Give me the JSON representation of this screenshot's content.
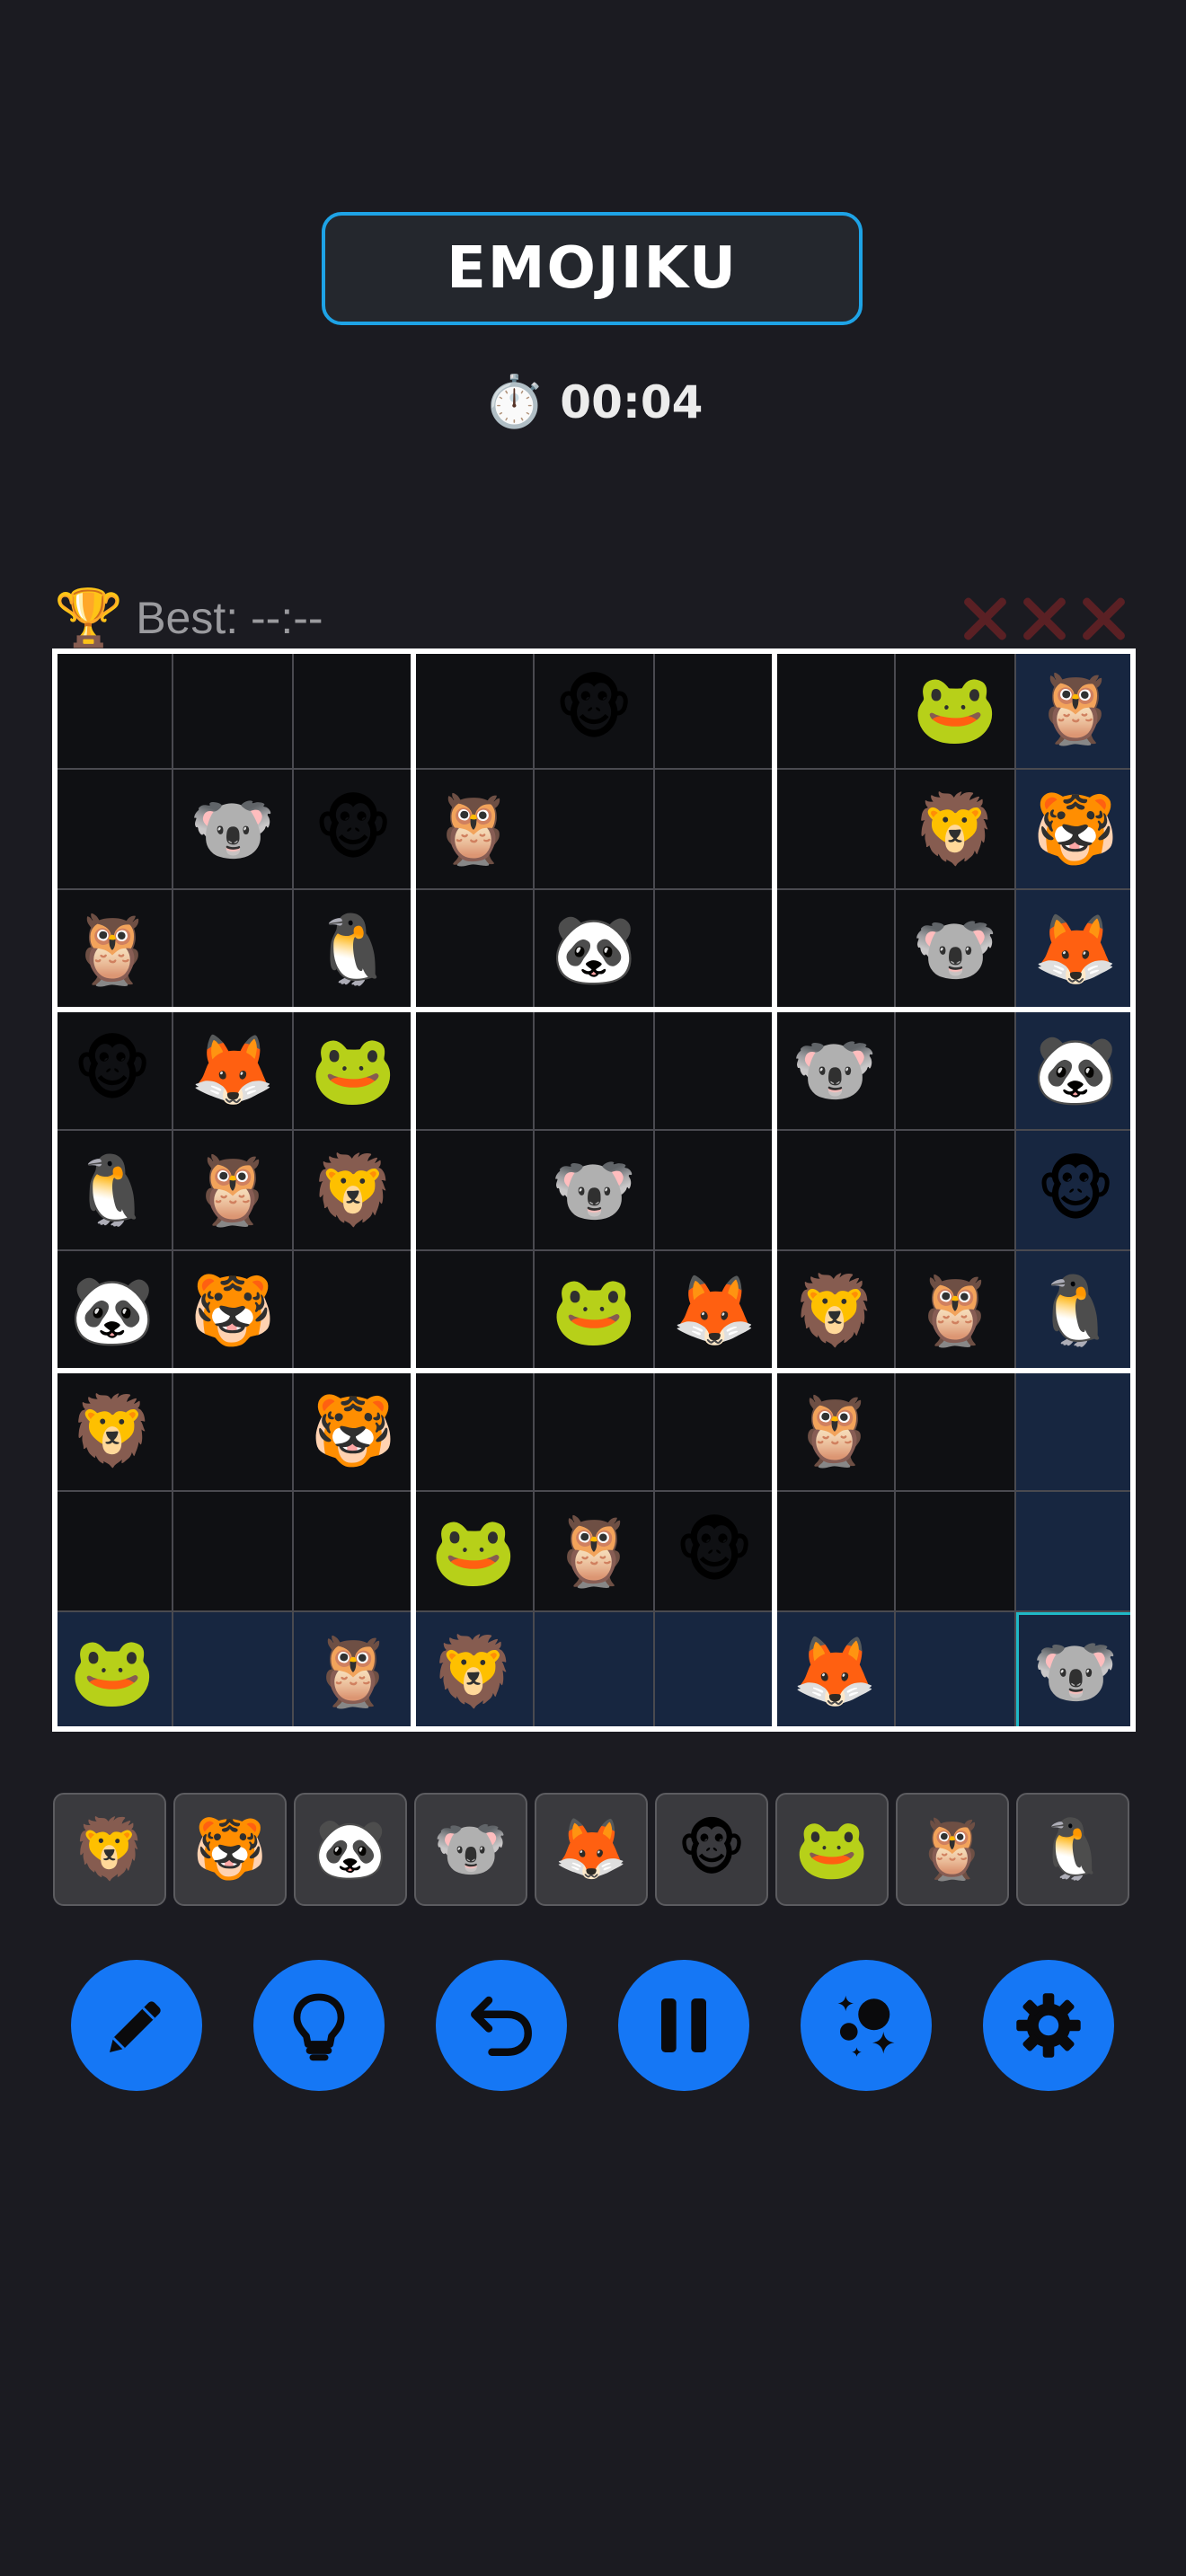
{
  "header": {
    "title": "EMOJIKU",
    "timer_icon": "⏱️",
    "timer": "00:04"
  },
  "stats": {
    "trophy_icon": "🏆",
    "best": "Best: --:--",
    "mistakes": {
      "made": 0,
      "max": 3
    }
  },
  "board": {
    "emoji_legend": {
      "L": "🦁",
      "T": "🐯",
      "P": "🐼",
      "K": "🐨",
      "F": "🦊",
      "M": "🐵",
      "G": "🐸",
      "O": "🦉",
      "U": "🐧"
    },
    "rows": [
      [
        "",
        "",
        "",
        "",
        "🐵",
        "",
        "",
        "🐸",
        "🦉"
      ],
      [
        "",
        "🐨",
        "🐵",
        "🦉",
        "",
        "",
        "",
        "🦁",
        "🐯"
      ],
      [
        "🦉",
        "",
        "🐧",
        "",
        "🐼",
        "",
        "",
        "🐨",
        "🦊"
      ],
      [
        "🐵",
        "🦊",
        "🐸",
        "",
        "",
        "",
        "🐨",
        "",
        "🐼"
      ],
      [
        "🐧",
        "🦉",
        "🦁",
        "",
        "🐨",
        "",
        "",
        "",
        "🐵"
      ],
      [
        "🐼",
        "🐯",
        "",
        "",
        "🐸",
        "🦊",
        "🦁",
        "🦉",
        "🐧"
      ],
      [
        "🦁",
        "",
        "🐯",
        "",
        "",
        "",
        "🦉",
        "",
        ""
      ],
      [
        "",
        "",
        "",
        "🐸",
        "🦉",
        "🐵",
        "",
        "",
        ""
      ],
      [
        "🐸",
        "",
        "🦉",
        "🦁",
        "",
        "",
        "🦊",
        "",
        "🐨"
      ]
    ],
    "selected": {
      "row": 8,
      "col": 8
    }
  },
  "palette": [
    {
      "name": "lion",
      "emoji": "🦁"
    },
    {
      "name": "tiger",
      "emoji": "🐯"
    },
    {
      "name": "panda",
      "emoji": "🐼"
    },
    {
      "name": "koala",
      "emoji": "🐨"
    },
    {
      "name": "fox",
      "emoji": "🦊"
    },
    {
      "name": "monkey",
      "emoji": "🐵"
    },
    {
      "name": "frog",
      "emoji": "🐸"
    },
    {
      "name": "owl",
      "emoji": "🦉"
    },
    {
      "name": "penguin",
      "emoji": "🐧"
    }
  ],
  "toolbar": [
    {
      "name": "pencil-button",
      "icon": "pencil-icon"
    },
    {
      "name": "hint-button",
      "icon": "lightbulb-icon"
    },
    {
      "name": "undo-button",
      "icon": "undo-icon"
    },
    {
      "name": "pause-button",
      "icon": "pause-icon"
    },
    {
      "name": "magic-button",
      "icon": "sparkles-icon"
    },
    {
      "name": "settings-button",
      "icon": "gear-icon"
    }
  ],
  "colors": {
    "background": "#1b1b21",
    "accent": "#1577f5",
    "title_border": "#1ea3e6",
    "highlight": "#172640",
    "selection": "#1fb8c6",
    "mistake": "#5a2024"
  }
}
